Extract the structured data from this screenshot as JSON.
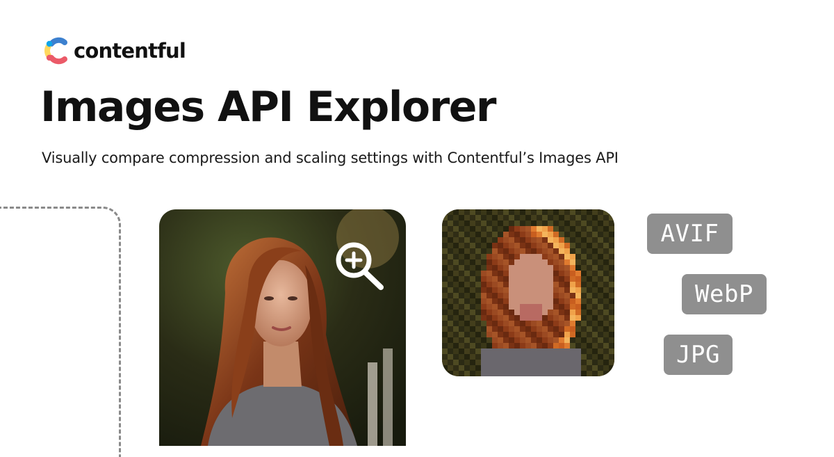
{
  "brand": {
    "name": "contentful",
    "logo_colors": [
      "#FFD85F",
      "#3C80CF",
      "#EB5A68",
      "#0EA5E9"
    ]
  },
  "header": {
    "title": "Images API Explorer",
    "subtitle": "Visually compare compression and scaling settings with Contentful’s Images API"
  },
  "preview": {
    "zoom_icon": "zoom-in-icon",
    "large_image": "portrait-photo",
    "small_image": "pixelated-portrait-photo"
  },
  "formats": [
    {
      "label": "AVIF"
    },
    {
      "label": "WebP"
    },
    {
      "label": "JPG"
    }
  ]
}
